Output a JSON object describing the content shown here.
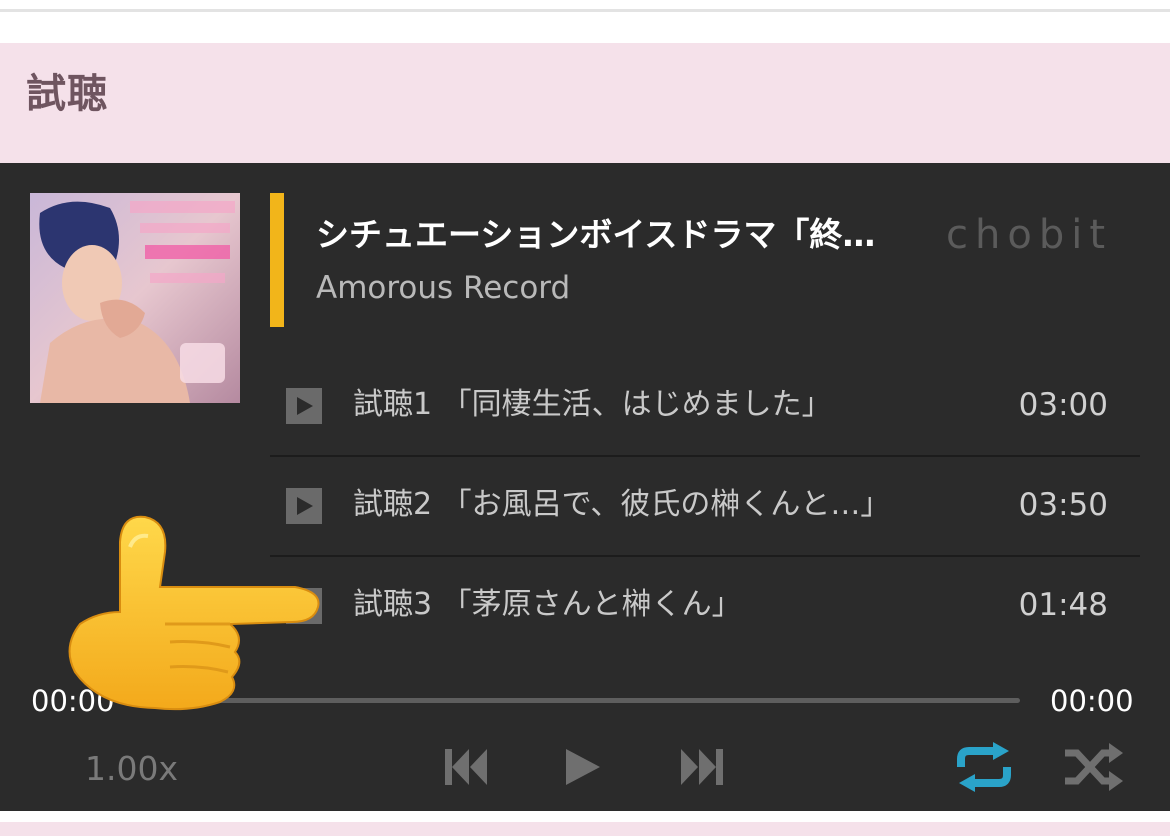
{
  "section": {
    "title": "試聴"
  },
  "player": {
    "cover_icon": "album-cover-art",
    "track_title": "シチュエーションボイスドラマ「終…",
    "artist": "Amorous Record",
    "brand": "chobit",
    "playlist": [
      {
        "label": "試聴1 「同棲生活、はじめました」",
        "duration": "03:00"
      },
      {
        "label": "試聴2 「お風呂で、彼氏の榊くんと…」",
        "duration": "03:50"
      },
      {
        "label": "試聴3 「茅原さんと榊くん」",
        "duration": "01:48"
      }
    ],
    "time_current": "00:00",
    "time_total": "00:00",
    "progress": 0,
    "speed": "1.00x",
    "controls": {
      "prev_icon": "skip-previous-icon",
      "play_icon": "play-icon",
      "next_icon": "skip-next-icon",
      "repeat_icon": "repeat-icon",
      "shuffle_icon": "shuffle-icon"
    }
  },
  "colors": {
    "header_bg": "#f5e1ea",
    "header_text": "#6f5560",
    "player_bg": "#2b2b2b",
    "accent": "#f2b51a",
    "repeat_active": "#2aa3c9"
  },
  "overlay": {
    "icon": "pointing-hand-emoji"
  }
}
